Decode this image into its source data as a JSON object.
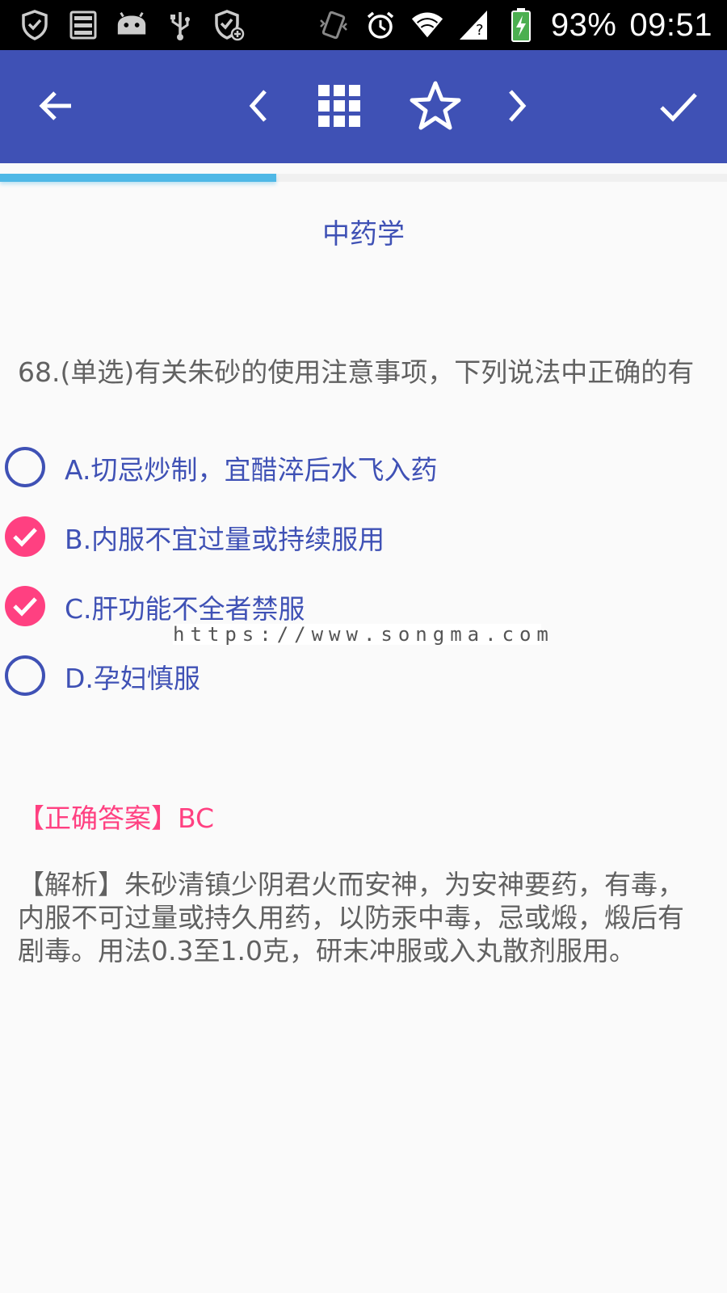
{
  "status_bar": {
    "battery": "93%",
    "time": "09:51",
    "icons": [
      "shield-check-icon",
      "storage-icon",
      "android-icon",
      "usb-icon",
      "shield-add-icon",
      "vibrate-icon",
      "alarm-icon",
      "wifi-icon",
      "sim-signal-icon",
      "battery-charging-icon"
    ]
  },
  "toolbar": {
    "icons": [
      "back-arrow-icon",
      "previous-icon",
      "grid-icon",
      "star-icon",
      "next-icon",
      "check-icon"
    ]
  },
  "progress": {
    "value": 0.38,
    "color": "#4fb8e6"
  },
  "subject": "中药学",
  "question": "68.(单选)有关朱砂的使用注意事项，下列说法中正确的有",
  "options": [
    {
      "label": "A.切忌炒制，宜醋淬后水飞入药",
      "checked": false
    },
    {
      "label": "B.内服不宜过量或持续服用",
      "checked": true
    },
    {
      "label": "C.肝功能不全者禁服",
      "checked": true
    },
    {
      "label": "D.孕妇慎服",
      "checked": false
    }
  ],
  "watermark": "https://www.songma.com",
  "answer": "【正确答案】BC",
  "analysis": "【解析】朱砂清镇少阴君火而安神，为安神要药，有毒，内服不可过量或持久用药，以防汞中毒，忌或煅，煅后有剧毒。用法0.3至1.0克，研末冲服或入丸散剂服用。",
  "colors": {
    "primary": "#3f51b5",
    "accent": "#ff4081",
    "text": "#616161"
  }
}
